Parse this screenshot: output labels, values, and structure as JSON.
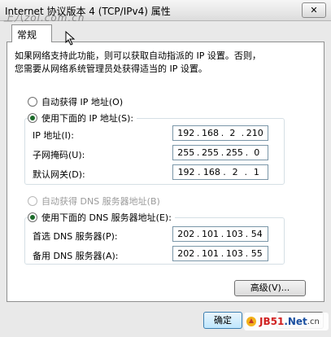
{
  "window": {
    "title": "Internet 协议版本 4 (TCP/IPv4) 属性",
    "close_label": "✕"
  },
  "watermark_top": "上八zol.com.cn",
  "tabs": [
    {
      "label": "常规"
    }
  ],
  "description": {
    "line1": "如果网络支持此功能，则可以获取自动指派的 IP 设置。否则，",
    "line2": "您需要从网络系统管理员处获得适当的 IP 设置。"
  },
  "ip": {
    "auto_label": "自动获得 IP 地址(O)",
    "manual_label": "使用下面的 IP 地址(S):",
    "fields": [
      {
        "label": "IP 地址(I):",
        "octets": [
          "192",
          "168",
          "2",
          "210"
        ]
      },
      {
        "label": "子网掩码(U):",
        "octets": [
          "255",
          "255",
          "255",
          "0"
        ]
      },
      {
        "label": "默认网关(D):",
        "octets": [
          "192",
          "168",
          "2",
          "1"
        ]
      }
    ]
  },
  "dns": {
    "auto_label": "自动获得 DNS 服务器地址(B)",
    "manual_label": "使用下面的 DNS 服务器地址(E):",
    "fields": [
      {
        "label": "首选 DNS 服务器(P):",
        "octets": [
          "202",
          "101",
          "103",
          "54"
        ]
      },
      {
        "label": "备用 DNS 服务器(A):",
        "octets": [
          "202",
          "101",
          "103",
          "55"
        ]
      }
    ]
  },
  "buttons": {
    "advanced": "高级(V)...",
    "ok": "确定"
  },
  "watermark_bottom": {
    "part_a": "JB51",
    "part_b": ".Net",
    "part_c": ".cn"
  }
}
